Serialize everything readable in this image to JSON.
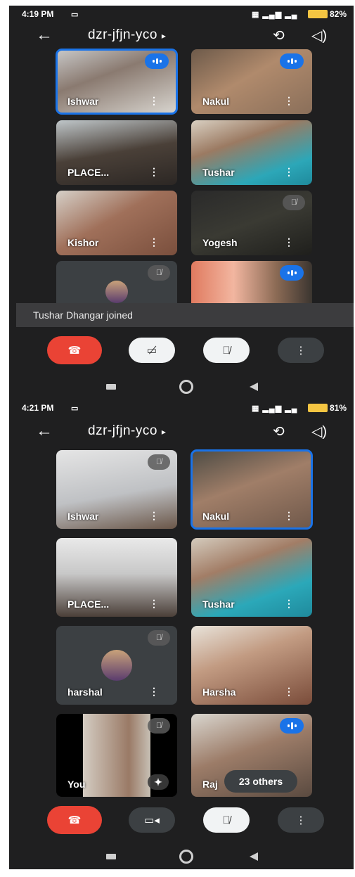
{
  "screen1": {
    "status": {
      "time": "4:19 PM",
      "battery": "82%"
    },
    "meeting": {
      "code": "dzr-jfjn-yco"
    },
    "tiles": [
      {
        "name": "Ishwar"
      },
      {
        "name": "Nakul"
      },
      {
        "name": "PLACE..."
      },
      {
        "name": "Tushar"
      },
      {
        "name": "Kishor"
      },
      {
        "name": "Yogesh"
      }
    ],
    "toast": "Tushar Dhangar joined"
  },
  "screen2": {
    "status": {
      "time": "4:21 PM",
      "battery": "81%"
    },
    "meeting": {
      "code": "dzr-jfjn-yco"
    },
    "tiles": [
      {
        "name": "Ishwar"
      },
      {
        "name": "Nakul"
      },
      {
        "name": "PLACE..."
      },
      {
        "name": "Tushar"
      },
      {
        "name": "harshal"
      },
      {
        "name": "Harsha"
      },
      {
        "name": "You"
      },
      {
        "name": "Raj"
      }
    ],
    "others_chip": "23 others"
  },
  "icons": {
    "back": "arrow-left-icon",
    "switch_camera": "switch-camera-icon",
    "speaker": "speaker-icon",
    "end_call": "end-call-icon",
    "camera": "camera-icon",
    "mic_off": "mic-off-icon",
    "more": "more-vert-icon"
  },
  "colors": {
    "accent": "#1a73e8",
    "end_call": "#ea4335",
    "background": "#1f1f20"
  }
}
